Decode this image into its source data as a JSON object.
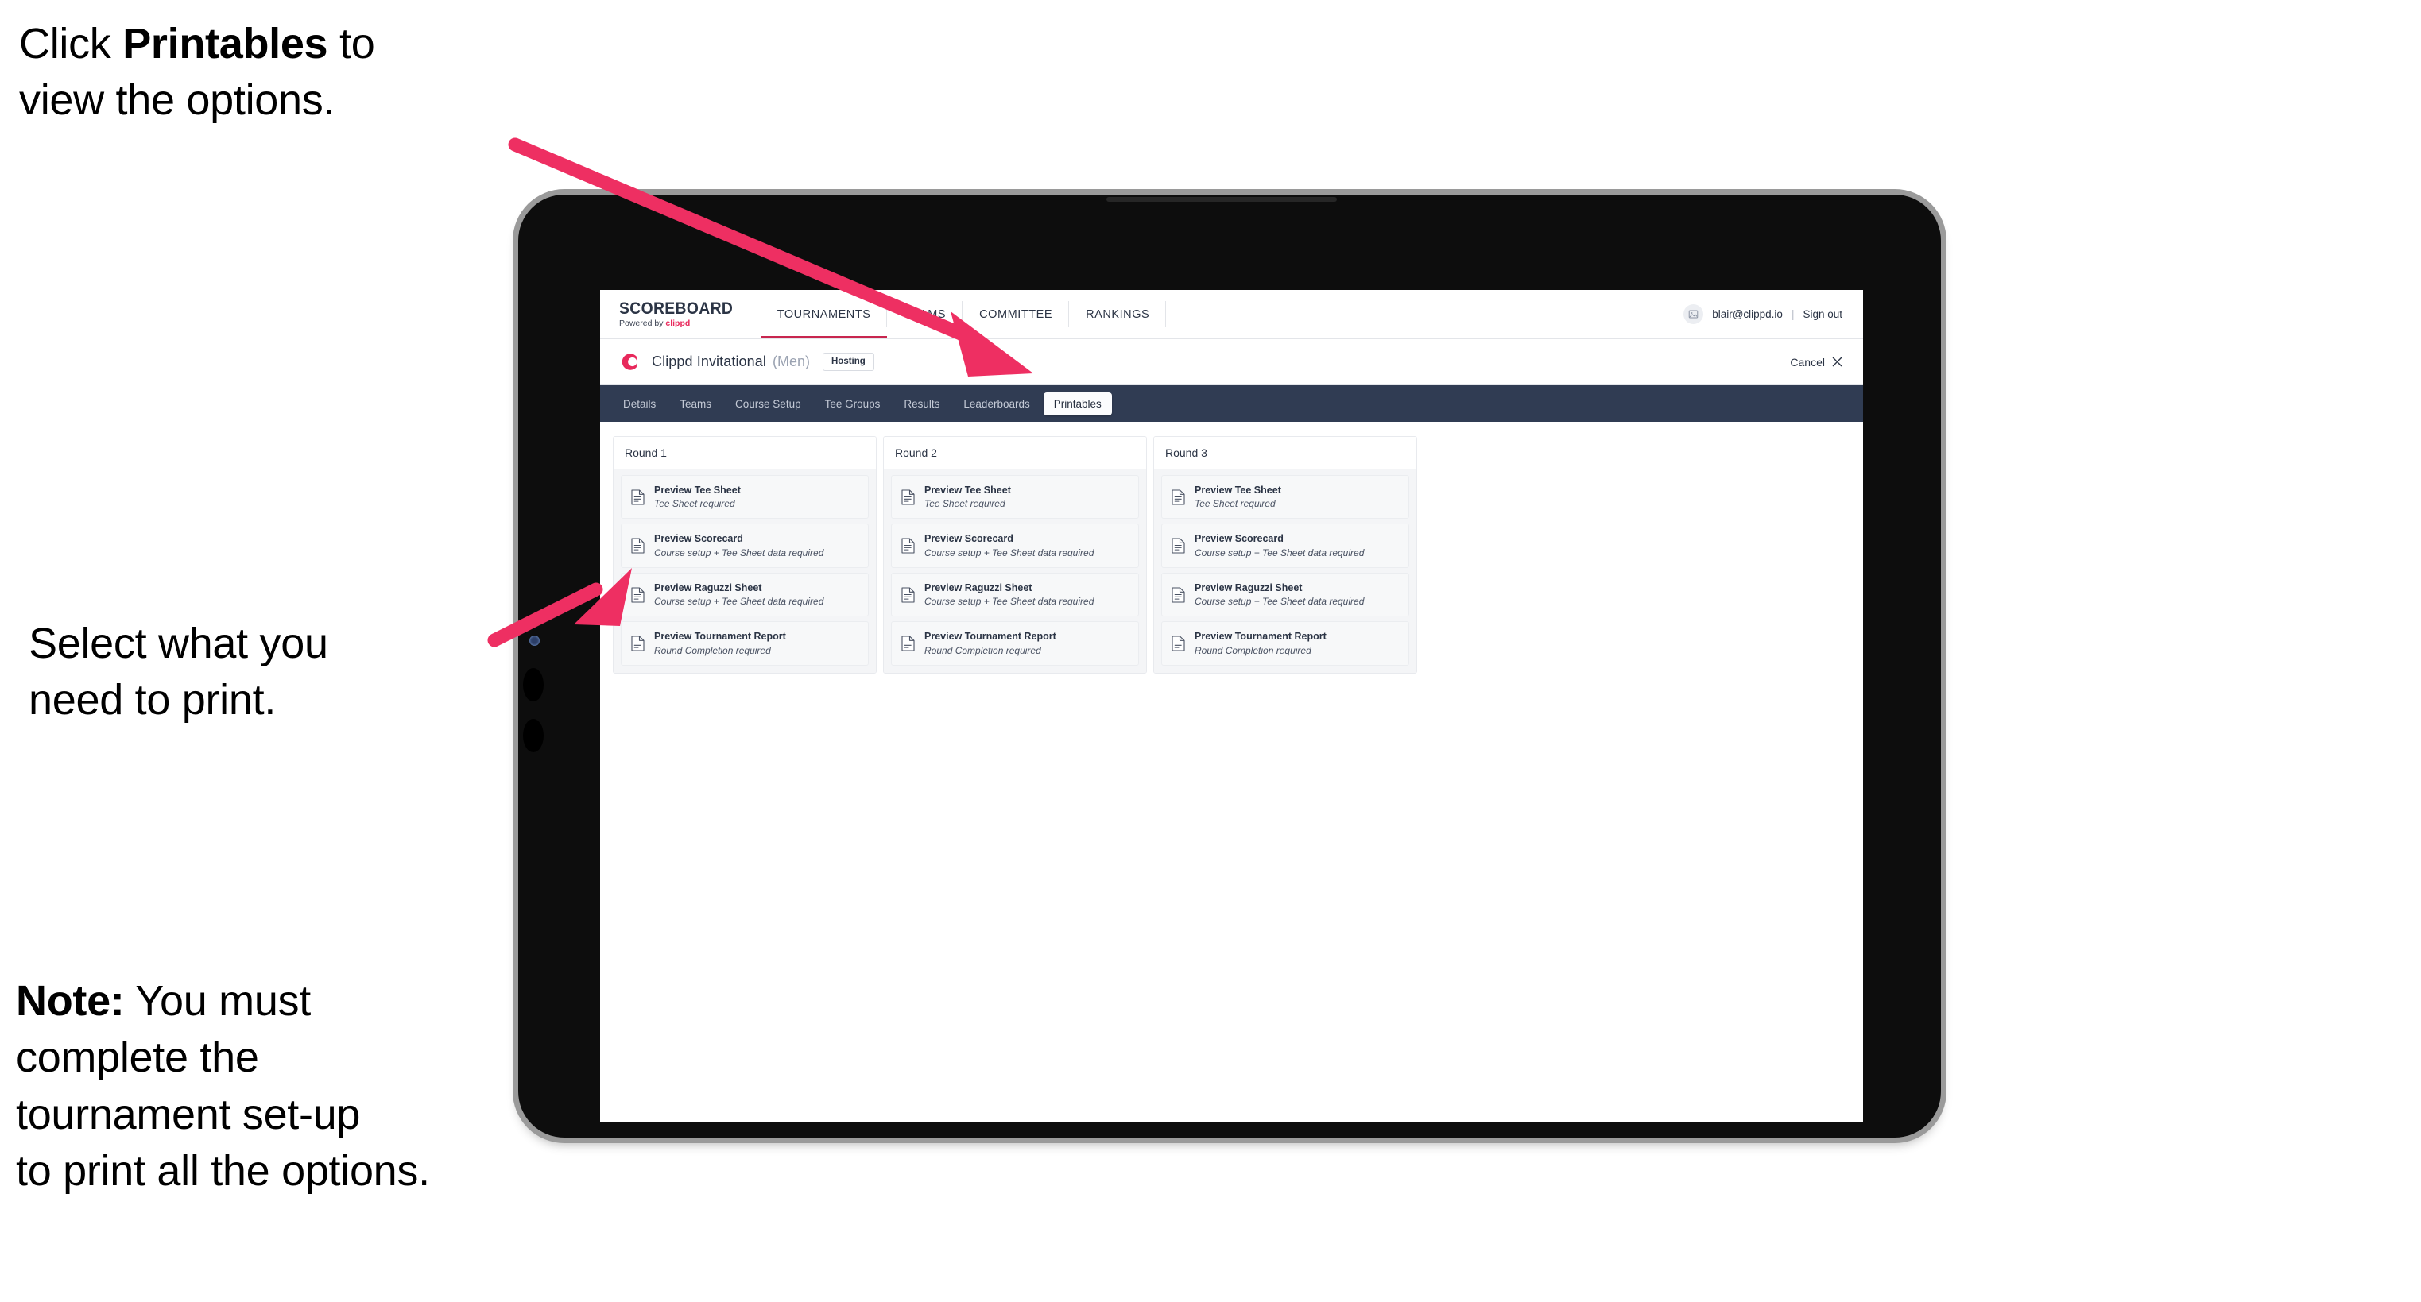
{
  "annotations": {
    "click_printables": {
      "prefix": "Click ",
      "bold": "Printables",
      "suffix": " to\nview the options."
    },
    "select_print": "Select what you\n need to print.",
    "note": {
      "bold": "Note:",
      "text": " You must\ncomplete the\ntournament set-up\nto print all the options."
    }
  },
  "colors": {
    "accent_pink": "#e8295c",
    "arrow_pink": "#ee2f62",
    "navbar_dark": "#303c53",
    "tablet_body": "#0d0d0d",
    "tablet_bezel": "#9a9a9a",
    "text_dark": "#2b3445"
  },
  "app": {
    "brand": {
      "title": "SCOREBOARD",
      "powered_by": "Powered by ",
      "powered_by_brand": "clippd"
    },
    "main_nav": [
      {
        "label": "TOURNAMENTS",
        "active": true
      },
      {
        "label": "TEAMS",
        "active": false
      },
      {
        "label": "COMMITTEE",
        "active": false
      },
      {
        "label": "RANKINGS",
        "active": false
      }
    ],
    "user": {
      "email": "blair@clippd.io",
      "divider": "|",
      "sign_out": "Sign out",
      "avatar_icon": "user-avatar-icon"
    },
    "title_row": {
      "logo_icon": "clippd-c-logo-icon",
      "tournament_name": "Clippd Invitational",
      "gender": "(Men)",
      "badge": "Hosting",
      "cancel_label": "Cancel",
      "cancel_icon": "close-x-icon"
    },
    "tabs": [
      {
        "label": "Details",
        "active": false
      },
      {
        "label": "Teams",
        "active": false
      },
      {
        "label": "Course Setup",
        "active": false
      },
      {
        "label": "Tee Groups",
        "active": false
      },
      {
        "label": "Results",
        "active": false
      },
      {
        "label": "Leaderboards",
        "active": false
      },
      {
        "label": "Printables",
        "active": true
      }
    ],
    "rounds": [
      {
        "title": "Round 1",
        "items": [
          {
            "title": "Preview Tee Sheet",
            "sub": "Tee Sheet required"
          },
          {
            "title": "Preview Scorecard",
            "sub": "Course setup + Tee Sheet data required"
          },
          {
            "title": "Preview Raguzzi Sheet",
            "sub": "Course setup + Tee Sheet data required"
          },
          {
            "title": "Preview Tournament Report",
            "sub": "Round Completion required"
          }
        ]
      },
      {
        "title": "Round 2",
        "items": [
          {
            "title": "Preview Tee Sheet",
            "sub": "Tee Sheet required"
          },
          {
            "title": "Preview Scorecard",
            "sub": "Course setup + Tee Sheet data required"
          },
          {
            "title": "Preview Raguzzi Sheet",
            "sub": "Course setup + Tee Sheet data required"
          },
          {
            "title": "Preview Tournament Report",
            "sub": "Round Completion required"
          }
        ]
      },
      {
        "title": "Round 3",
        "items": [
          {
            "title": "Preview Tee Sheet",
            "sub": "Tee Sheet required"
          },
          {
            "title": "Preview Scorecard",
            "sub": "Course setup + Tee Sheet data required"
          },
          {
            "title": "Preview Raguzzi Sheet",
            "sub": "Course setup + Tee Sheet data required"
          },
          {
            "title": "Preview Tournament Report",
            "sub": "Round Completion required"
          }
        ]
      }
    ]
  }
}
